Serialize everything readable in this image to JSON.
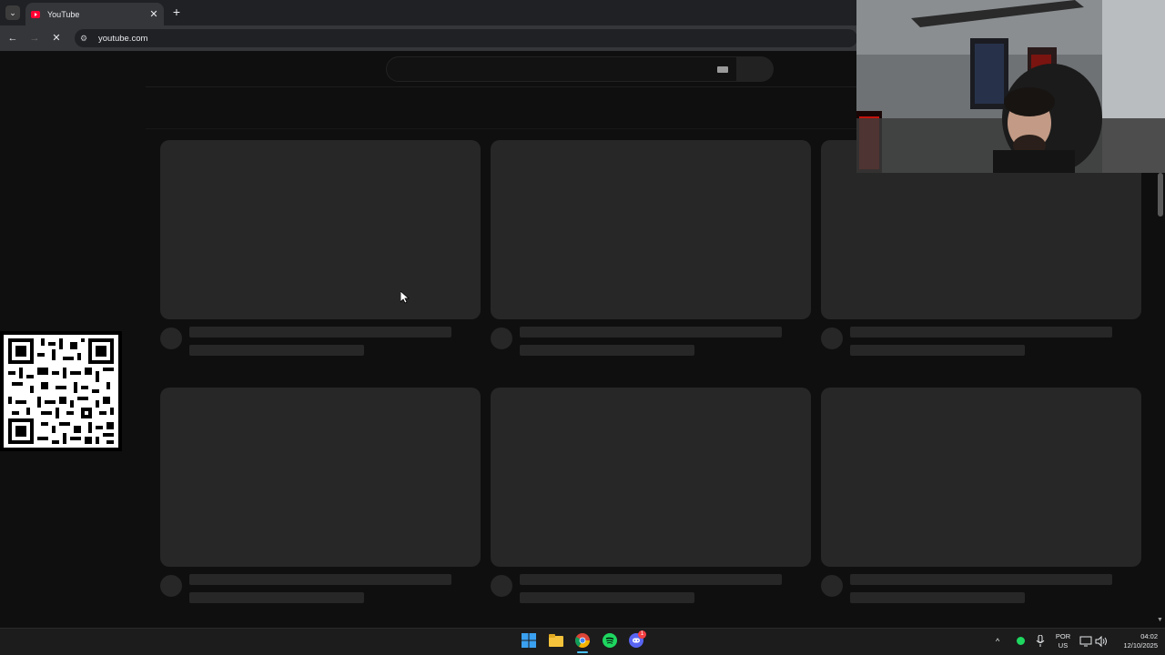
{
  "browser": {
    "tab_title": "YouTube",
    "tab_close": "✕",
    "new_tab": "+",
    "tab_menu": "⌄",
    "url": "youtube.com",
    "back": "←",
    "forward": "→",
    "stop": "✕",
    "site_info": "⚙"
  },
  "taskbar": {
    "icons": [
      "windows-start-icon",
      "file-explorer-icon",
      "chrome-icon",
      "spotify-icon",
      "discord-icon"
    ],
    "discord_badge": "1",
    "tray_chevron": "^",
    "lang_top": "POR",
    "lang_bottom": "US",
    "time": "04:02",
    "date": "12/10/2025"
  },
  "colors": {
    "page_bg": "#0f0f0f",
    "skeleton": "#272727",
    "youtube_red": "#ff0033"
  }
}
